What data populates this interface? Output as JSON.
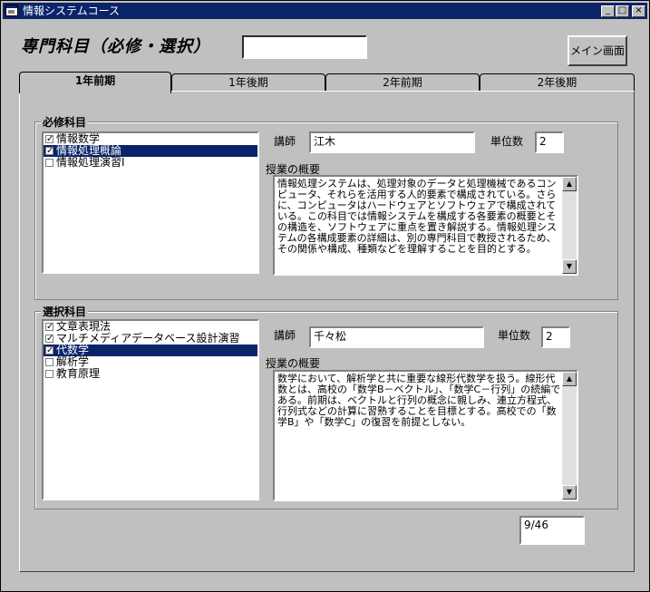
{
  "window": {
    "title": "情報システムコース",
    "controls": {
      "minimize": "_",
      "maximize": "□",
      "close": "×"
    }
  },
  "header": {
    "title": "専門科目（必修・選択）",
    "search_value": "",
    "main_button": "メイン画面"
  },
  "tabs": [
    {
      "label": "1年前期",
      "active": true
    },
    {
      "label": "1年後期",
      "active": false
    },
    {
      "label": "2年前期",
      "active": false
    },
    {
      "label": "2年後期",
      "active": false
    }
  ],
  "required": {
    "group_label": "必修科目",
    "items": [
      {
        "label": "情報数学",
        "checked": true,
        "selected": false
      },
      {
        "label": "情報処理概論",
        "checked": true,
        "selected": true
      },
      {
        "label": "情報処理演習Ⅰ",
        "checked": false,
        "selected": false
      }
    ],
    "instructor_label": "講師",
    "instructor": "江木",
    "credits_label": "単位数",
    "credits": "2",
    "summary_label": "授業の概要",
    "summary": "情報処理システムは、処理対象のデータと処理機械であるコンピュータ、それらを活用する人的要素で構成されている。さらに、コンピュータはハードウェアとソフトウェアで構成されている。この科目では情報システムを構成する各要素の概要とその構造を、ソフトウェアに重点を置き解説する。情報処理システムの各構成要素の詳細は、別の専門科目で教授されるため、その関係や構成、種類などを理解することを目的とする。"
  },
  "elective": {
    "group_label": "選択科目",
    "items": [
      {
        "label": "文章表現法",
        "checked": true,
        "selected": false
      },
      {
        "label": "マルチメディアデータベース設計演習",
        "checked": true,
        "selected": false
      },
      {
        "label": "代数学",
        "checked": true,
        "selected": true
      },
      {
        "label": "解析学",
        "checked": false,
        "selected": false
      },
      {
        "label": "教育原理",
        "checked": false,
        "selected": false
      }
    ],
    "instructor_label": "講師",
    "instructor": "千々松",
    "credits_label": "単位数",
    "credits": "2",
    "summary_label": "授業の概要",
    "summary": "数学において、解析学と共に重要な線形代数学を扱う。線形代数とは、高校の「数学B－ベクトル」、「数学C－行列」の続編である。前期は、ベクトルと行列の概念に親しみ、連立方程式、行列式などの計算に習熟することを目標とする。高校での「数学B」や「数学C」の復習を前提としない。"
  },
  "footer": {
    "page_counter": "9/46"
  }
}
